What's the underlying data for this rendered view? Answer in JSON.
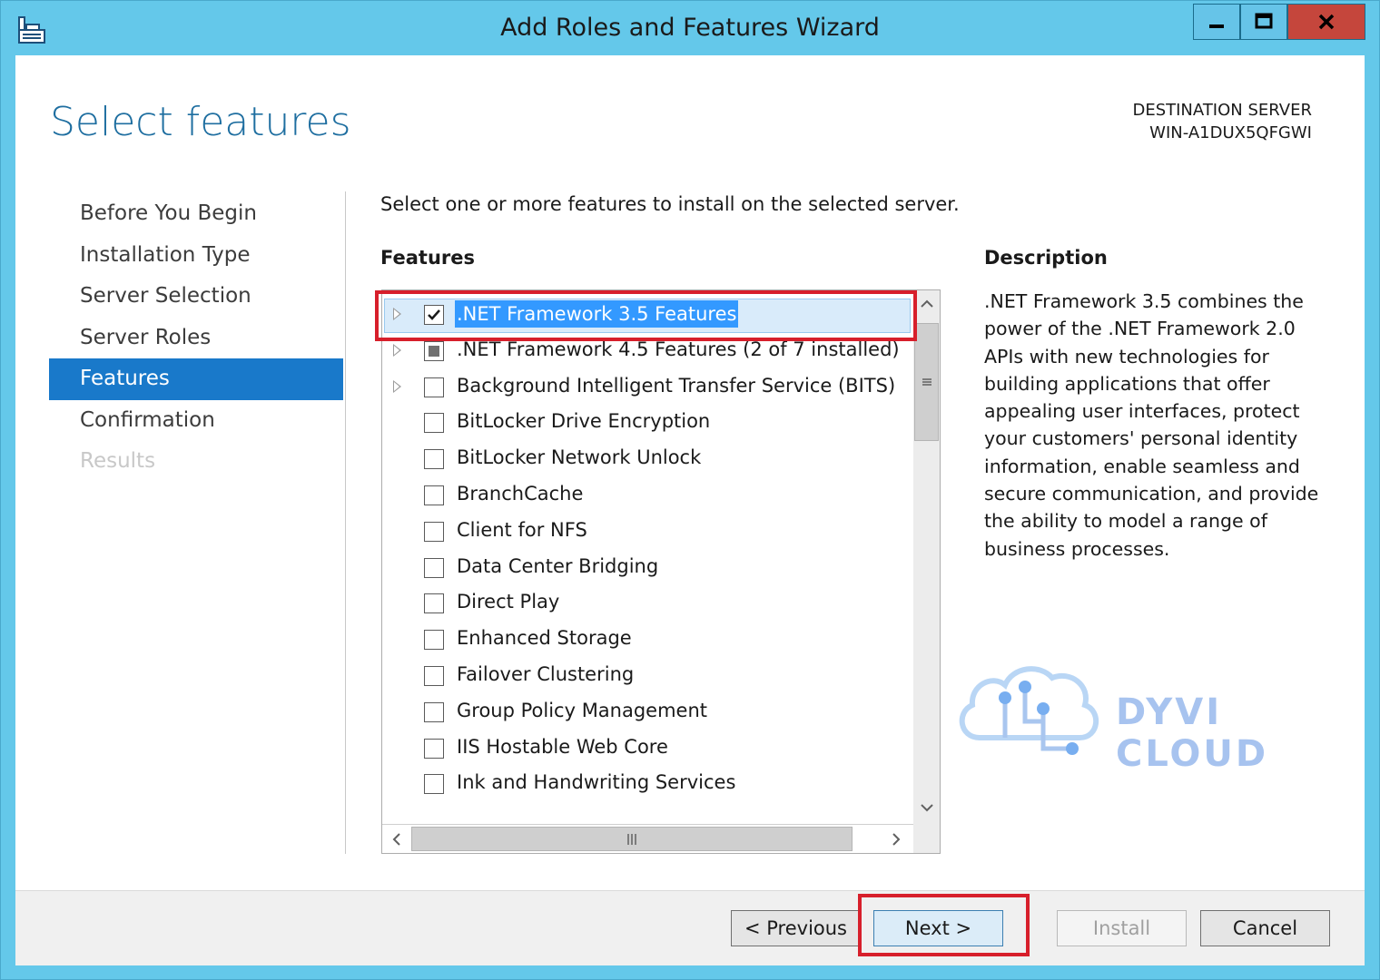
{
  "window": {
    "title": "Add Roles and Features Wizard"
  },
  "page": {
    "title": "Select features",
    "destination_label": "DESTINATION SERVER",
    "destination_server": "WIN-A1DUX5QFGWI"
  },
  "nav": {
    "items": [
      {
        "label": "Before You Begin",
        "state": "normal"
      },
      {
        "label": "Installation Type",
        "state": "normal"
      },
      {
        "label": "Server Selection",
        "state": "normal"
      },
      {
        "label": "Server Roles",
        "state": "normal"
      },
      {
        "label": "Features",
        "state": "active"
      },
      {
        "label": "Confirmation",
        "state": "normal"
      },
      {
        "label": "Results",
        "state": "disabled"
      }
    ]
  },
  "main": {
    "instruction": "Select one or more features to install on the selected server.",
    "features_heading": "Features",
    "features": [
      {
        "label": ".NET Framework 3.5 Features",
        "checked": "checked",
        "expandable": true,
        "selected": true
      },
      {
        "label": ".NET Framework 4.5 Features (2 of 7 installed)",
        "checked": "partial",
        "expandable": true,
        "selected": false
      },
      {
        "label": "Background Intelligent Transfer Service (BITS)",
        "checked": "unchecked",
        "expandable": true,
        "selected": false
      },
      {
        "label": "BitLocker Drive Encryption",
        "checked": "unchecked",
        "expandable": false,
        "selected": false
      },
      {
        "label": "BitLocker Network Unlock",
        "checked": "unchecked",
        "expandable": false,
        "selected": false
      },
      {
        "label": "BranchCache",
        "checked": "unchecked",
        "expandable": false,
        "selected": false
      },
      {
        "label": "Client for NFS",
        "checked": "unchecked",
        "expandable": false,
        "selected": false
      },
      {
        "label": "Data Center Bridging",
        "checked": "unchecked",
        "expandable": false,
        "selected": false
      },
      {
        "label": "Direct Play",
        "checked": "unchecked",
        "expandable": false,
        "selected": false
      },
      {
        "label": "Enhanced Storage",
        "checked": "unchecked",
        "expandable": false,
        "selected": false
      },
      {
        "label": "Failover Clustering",
        "checked": "unchecked",
        "expandable": false,
        "selected": false
      },
      {
        "label": "Group Policy Management",
        "checked": "unchecked",
        "expandable": false,
        "selected": false
      },
      {
        "label": "IIS Hostable Web Core",
        "checked": "unchecked",
        "expandable": false,
        "selected": false
      },
      {
        "label": "Ink and Handwriting Services",
        "checked": "unchecked",
        "expandable": false,
        "selected": false
      }
    ],
    "description_heading": "Description",
    "description_text": ".NET Framework 3.5 combines the power of the .NET Framework 2.0 APIs with new technologies for building applications that offer appealing user interfaces, protect your customers' personal identity information, enable seamless and secure communication, and provide the ability to model a range of business processes."
  },
  "footer": {
    "previous_label": "< Previous",
    "next_label": "Next >",
    "install_label": "Install",
    "cancel_label": "Cancel"
  },
  "watermark": {
    "text": "DYVI CLOUD"
  },
  "colors": {
    "titlebar": "#64c8ea",
    "accent": "#1979ca",
    "highlight_box": "#d71f2b",
    "close_button": "#c5463c",
    "watermark": "#a7c3ef"
  },
  "icons": {
    "app": "server-manager-icon",
    "minimize": "minimize-icon",
    "maximize": "maximize-icon",
    "close": "close-icon",
    "expand": "expand-triangle-icon",
    "check": "checkmark-icon",
    "scroll_up": "chevron-up-icon",
    "scroll_down": "chevron-down-icon",
    "scroll_left": "chevron-left-icon",
    "scroll_right": "chevron-right-icon",
    "watermark_logo": "cloud-circuit-icon"
  }
}
